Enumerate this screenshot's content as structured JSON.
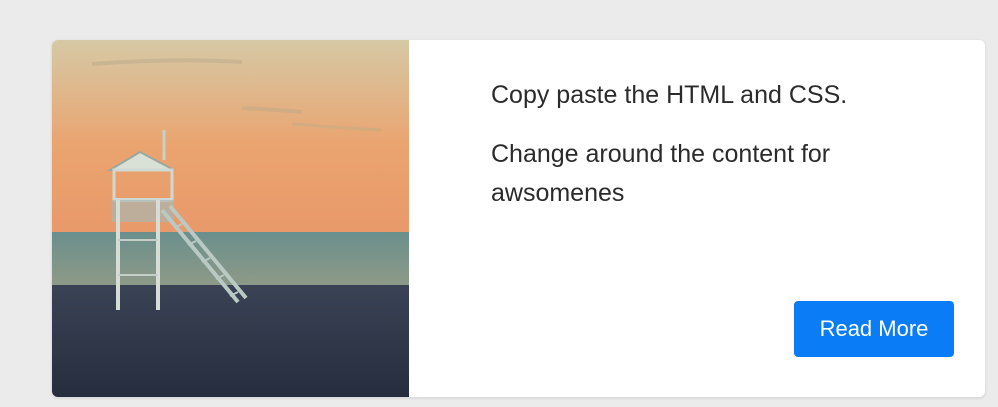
{
  "card": {
    "image": {
      "icon": "beach-lifeguard-tower-image",
      "colors": {
        "sky_top": "#d9c7a3",
        "sky_bottom": "#e8a06e",
        "sea": "#6f8d8a",
        "sand": "#2d3548",
        "tower": "#c9d4cf"
      }
    },
    "paragraph_1": "Copy paste the HTML and CSS.",
    "paragraph_2": "Change around the content for awsomenes",
    "button_label": "Read More",
    "button_color": "#0a7cf5"
  }
}
